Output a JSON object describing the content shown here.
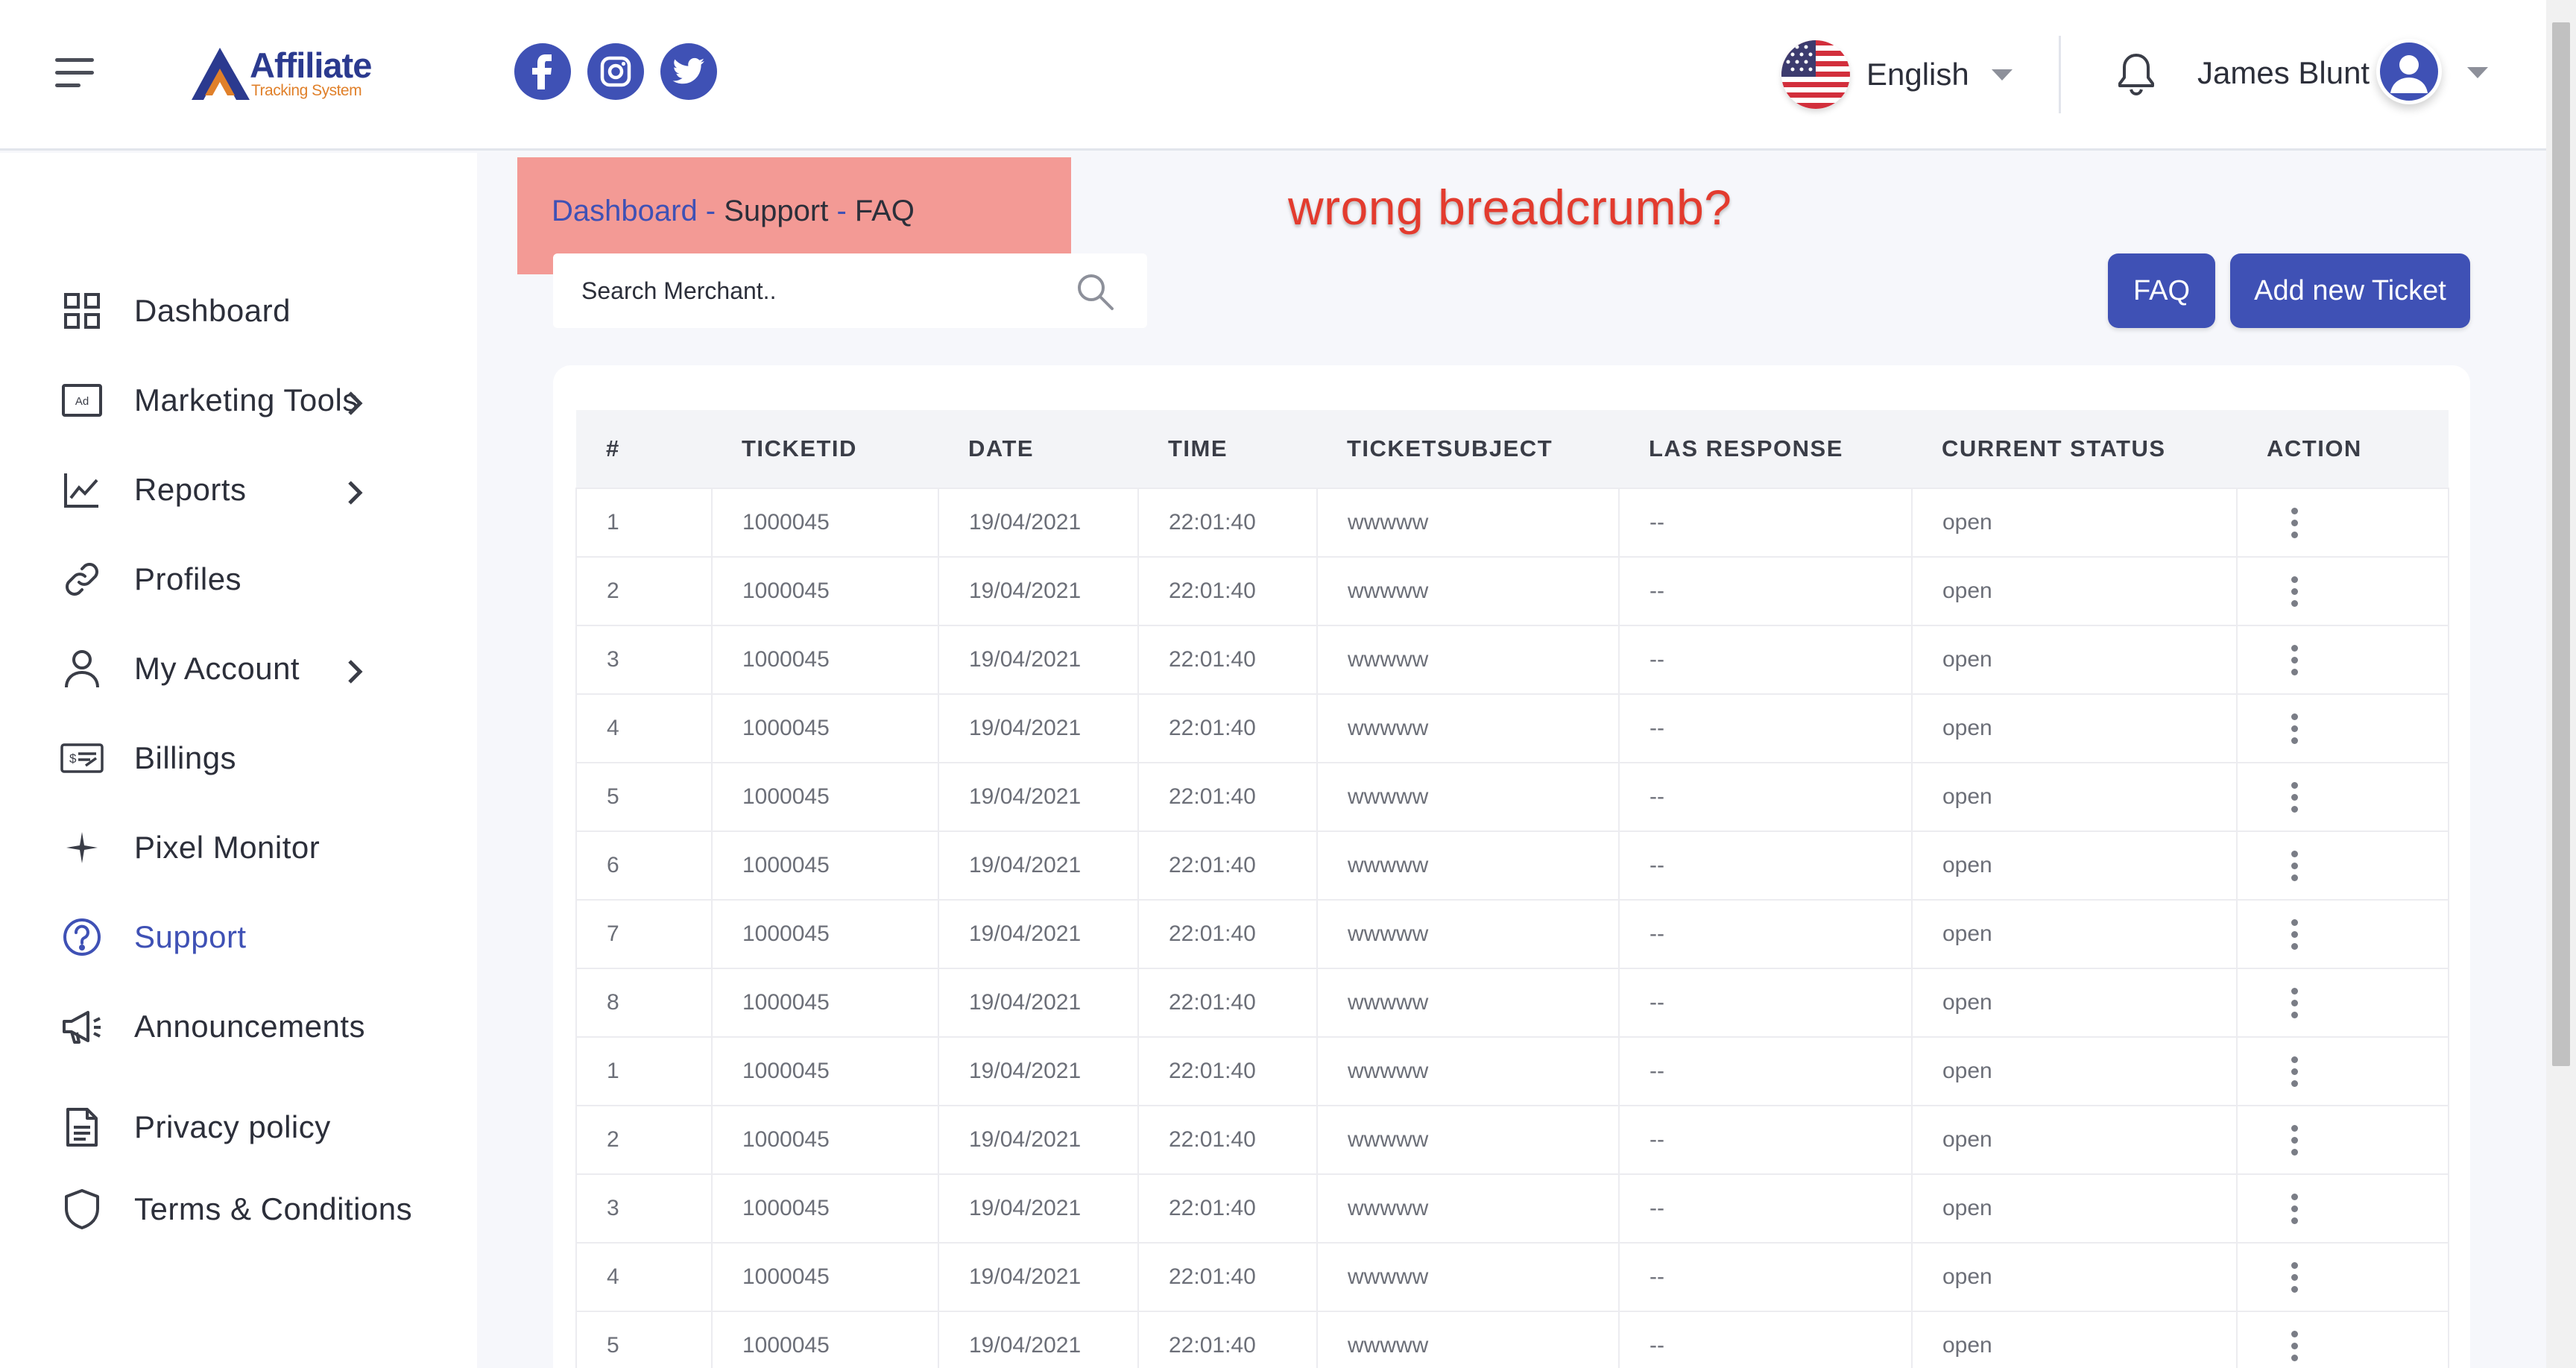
{
  "header": {
    "logo_title": "Affiliate",
    "logo_subtitle": "Tracking System",
    "social": [
      "facebook-icon",
      "instagram-icon",
      "twitter-icon"
    ],
    "language": "English",
    "user_name": "James Blunt"
  },
  "sidebar": {
    "items": [
      {
        "label": "Dashboard",
        "icon": "grid-icon",
        "has_submenu": false,
        "active": false
      },
      {
        "label": "Marketing Tools",
        "icon": "ad-icon",
        "has_submenu": true,
        "active": false
      },
      {
        "label": "Reports",
        "icon": "chart-line-icon",
        "has_submenu": true,
        "active": false
      },
      {
        "label": "Profiles",
        "icon": "link-icon",
        "has_submenu": false,
        "active": false
      },
      {
        "label": "My Account",
        "icon": "user-icon",
        "has_submenu": true,
        "active": false
      },
      {
        "label": "Billings",
        "icon": "cheque-icon",
        "has_submenu": false,
        "active": false
      },
      {
        "label": "Pixel Monitor",
        "icon": "sparkle-icon",
        "has_submenu": false,
        "active": false
      },
      {
        "label": "Support",
        "icon": "help-circle-icon",
        "has_submenu": false,
        "active": true
      },
      {
        "label": "Announcements",
        "icon": "megaphone-icon",
        "has_submenu": false,
        "active": false
      },
      {
        "label": "Privacy policy",
        "icon": "document-icon",
        "has_submenu": false,
        "active": false
      },
      {
        "label": "Terms & Conditions",
        "icon": "shield-icon",
        "has_submenu": false,
        "active": false
      }
    ]
  },
  "breadcrumb": {
    "items": [
      "Dashboard",
      "Support",
      "FAQ"
    ],
    "separator": " - "
  },
  "annotation": "wrong breadcrumb?",
  "search": {
    "placeholder": "Search Merchant.."
  },
  "buttons": {
    "faq": "FAQ",
    "add_ticket": "Add new Ticket"
  },
  "table": {
    "columns": [
      "#",
      "TICKETID",
      "DATE",
      "TIME",
      "TICKETSUBJECT",
      "LAS RESPONSE",
      "CURRENT STATUS",
      "ACTION"
    ],
    "rows": [
      [
        "1",
        "1000045",
        "19/04/2021",
        "22:01:40",
        "wwwww",
        "--",
        "open"
      ],
      [
        "2",
        "1000045",
        "19/04/2021",
        "22:01:40",
        "wwwww",
        "--",
        "open"
      ],
      [
        "3",
        "1000045",
        "19/04/2021",
        "22:01:40",
        "wwwww",
        "--",
        "open"
      ],
      [
        "4",
        "1000045",
        "19/04/2021",
        "22:01:40",
        "wwwww",
        "--",
        "open"
      ],
      [
        "5",
        "1000045",
        "19/04/2021",
        "22:01:40",
        "wwwww",
        "--",
        "open"
      ],
      [
        "6",
        "1000045",
        "19/04/2021",
        "22:01:40",
        "wwwww",
        "--",
        "open"
      ],
      [
        "7",
        "1000045",
        "19/04/2021",
        "22:01:40",
        "wwwww",
        "--",
        "open"
      ],
      [
        "8",
        "1000045",
        "19/04/2021",
        "22:01:40",
        "wwwww",
        "--",
        "open"
      ],
      [
        "1",
        "1000045",
        "19/04/2021",
        "22:01:40",
        "wwwww",
        "--",
        "open"
      ],
      [
        "2",
        "1000045",
        "19/04/2021",
        "22:01:40",
        "wwwww",
        "--",
        "open"
      ],
      [
        "3",
        "1000045",
        "19/04/2021",
        "22:01:40",
        "wwwww",
        "--",
        "open"
      ],
      [
        "4",
        "1000045",
        "19/04/2021",
        "22:01:40",
        "wwwww",
        "--",
        "open"
      ],
      [
        "5",
        "1000045",
        "19/04/2021",
        "22:01:40",
        "wwwww",
        "--",
        "open"
      ]
    ]
  },
  "colors": {
    "accent": "#3f51b5",
    "breadcrumb_highlight": "#f39a95",
    "annotation": "#e33b2e"
  }
}
